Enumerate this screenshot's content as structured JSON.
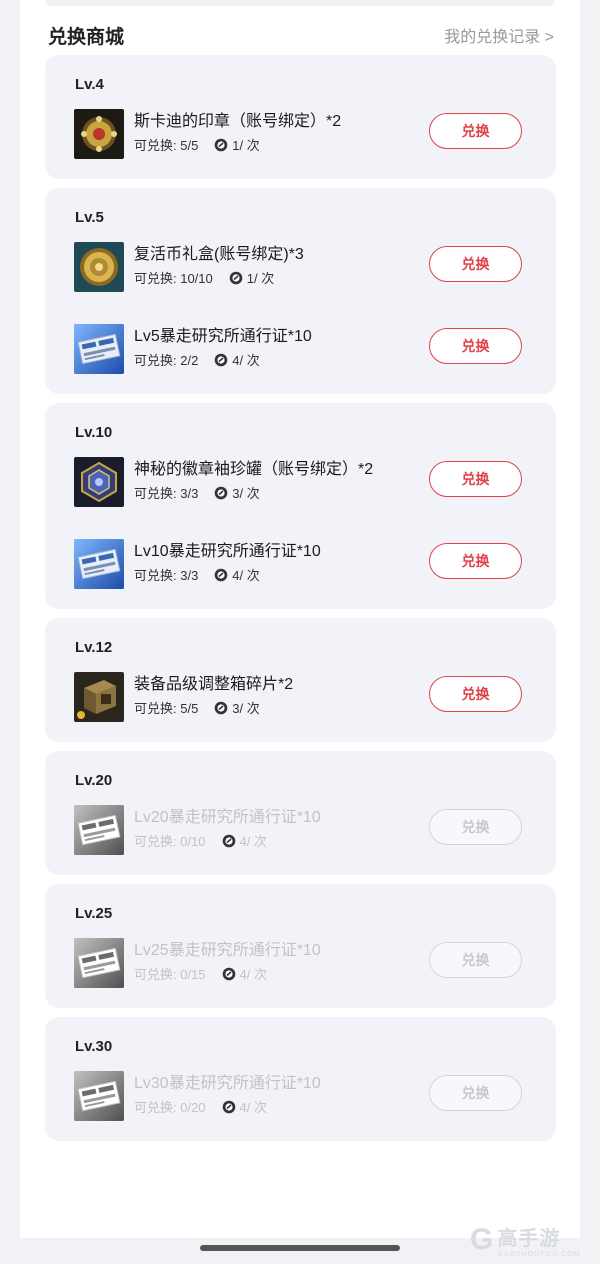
{
  "header": {
    "title": "兑换商城",
    "record_link": "我的兑换记录 >"
  },
  "coin_icon": "pass-coin-icon",
  "button_label": "兑换",
  "colors": {
    "accent": "#e0424a",
    "card_bg": "#f1f3f8",
    "disabled_text": "#c3c3c3"
  },
  "groups": [
    {
      "level": "Lv.4",
      "items": [
        {
          "name": "斯卡迪的印章（账号绑定）*2",
          "limit": "可兑换: 5/5",
          "cost": "1/ 次",
          "icon": "seal-icon",
          "enabled": true
        }
      ]
    },
    {
      "level": "Lv.5",
      "items": [
        {
          "name": "复活币礼盒(账号绑定)*3",
          "limit": "可兑换: 10/10",
          "cost": "1/ 次",
          "icon": "revive-coin-box-icon",
          "enabled": true
        },
        {
          "name": "Lv5暴走研究所通行证*10",
          "limit": "可兑换: 2/2",
          "cost": "4/ 次",
          "icon": "pass-ticket-icon",
          "enabled": true
        }
      ]
    },
    {
      "level": "Lv.10",
      "items": [
        {
          "name": "神秘的徽章袖珍罐（账号绑定）*2",
          "limit": "可兑换: 3/3",
          "cost": "3/ 次",
          "icon": "badge-jar-icon",
          "enabled": true
        },
        {
          "name": "Lv10暴走研究所通行证*10",
          "limit": "可兑换: 3/3",
          "cost": "4/ 次",
          "icon": "pass-ticket-icon",
          "enabled": true
        }
      ]
    },
    {
      "level": "Lv.12",
      "items": [
        {
          "name": "装备品级调整箱碎片*2",
          "limit": "可兑换: 5/5",
          "cost": "3/ 次",
          "icon": "equipment-box-icon",
          "enabled": true
        }
      ]
    },
    {
      "level": "Lv.20",
      "items": [
        {
          "name": "Lv20暴走研究所通行证*10",
          "limit": "可兑换: 0/10",
          "cost": "4/ 次",
          "icon": "pass-ticket-icon",
          "enabled": false
        }
      ]
    },
    {
      "level": "Lv.25",
      "items": [
        {
          "name": "Lv25暴走研究所通行证*10",
          "limit": "可兑换: 0/15",
          "cost": "4/ 次",
          "icon": "pass-ticket-icon",
          "enabled": false
        }
      ]
    },
    {
      "level": "Lv.30",
      "items": [
        {
          "name": "Lv30暴走研究所通行证*10",
          "limit": "可兑换: 0/20",
          "cost": "4/ 次",
          "icon": "pass-ticket-icon",
          "enabled": false
        }
      ]
    }
  ],
  "watermark": {
    "logo": "G",
    "name": "高手游",
    "domain": "GAOSHOUYOU.COM"
  }
}
